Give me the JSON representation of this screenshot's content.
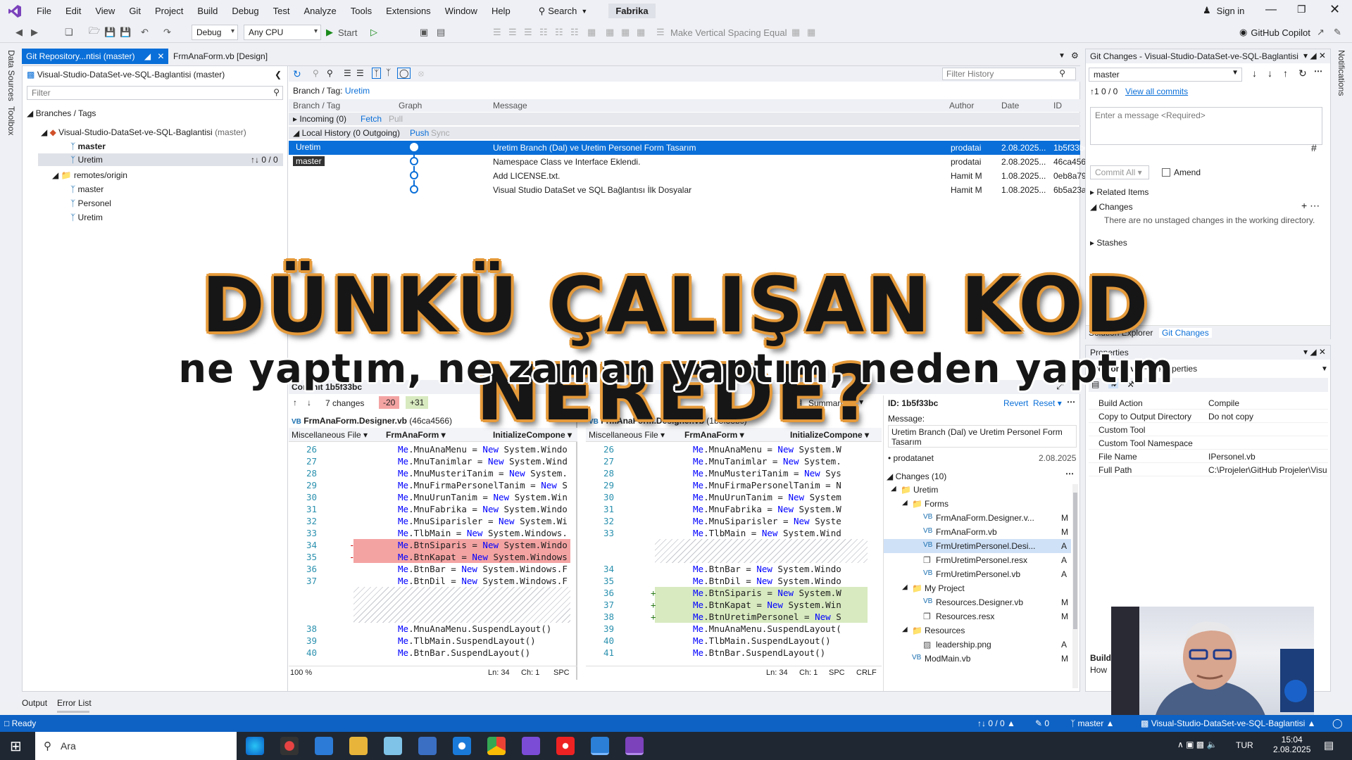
{
  "title_bar": {
    "menus": [
      "File",
      "Edit",
      "View",
      "Git",
      "Project",
      "Build",
      "Debug",
      "Test",
      "Analyze",
      "Tools",
      "Extensions",
      "Window",
      "Help"
    ],
    "search_label": "Search",
    "solution_name": "Fabrika",
    "sign_in": "Sign in"
  },
  "toolbar": {
    "config": "Debug",
    "platform": "Any CPU",
    "start_label": "Start",
    "vertical_spacing": "Make Vertical Spacing Equal",
    "copilot": "GitHub Copilot"
  },
  "left_strip": {
    "tab1": "Data Sources",
    "tab2": "Toolbox"
  },
  "doc_tabs": {
    "active": "Git Repository...ntisi (master)",
    "other": "FrmAnaForm.vb [Design]"
  },
  "repo": {
    "header": "Visual-Studio-DataSet-ve-SQL-Baglantisi (master)",
    "filter_placeholder": "Filter",
    "branches_title": "Branches / Tags",
    "repo_name": "Visual-Studio-DataSet-ve-SQL-Baglantisi",
    "repo_branch": "(master)",
    "local_master": "master",
    "local_uretim": "Uretim",
    "uretim_sync": "↑↓ 0 / 0",
    "remotes": "remotes/origin",
    "remote_branches": [
      "master",
      "Personel",
      "Uretim"
    ]
  },
  "history": {
    "filter_placeholder": "Filter History",
    "branch_label": "Branch / Tag:",
    "branch_value": "Uretim",
    "columns": {
      "branch": "Branch / Tag",
      "graph": "Graph",
      "message": "Message",
      "author": "Author",
      "date": "Date",
      "id": "ID"
    },
    "incoming": "Incoming (0)",
    "fetch": "Fetch",
    "pull": "Pull",
    "local": "Local History (0 Outgoing)",
    "push": "Push",
    "sync": "Sync",
    "commits": [
      {
        "tag": "Uretim",
        "message": "Uretim Branch (Dal) ve Uretim Personel Form Tasarım",
        "author": "prodatai",
        "date": "2.08.2025...",
        "id": "1b5f33bc"
      },
      {
        "tag": "master",
        "message": "Namespace Class ve Interface Eklendi.",
        "author": "prodatai",
        "date": "2.08.2025...",
        "id": "46ca4566"
      },
      {
        "tag": "",
        "message": "Add LICENSE.txt.",
        "author": "Hamit M",
        "date": "1.08.2025...",
        "id": "0eb8a79e"
      },
      {
        "tag": "",
        "message": "Visual Studio DataSet ve SQL Bağlantısı İlk Dosyalar",
        "author": "Hamit M",
        "date": "1.08.2025...",
        "id": "6b5a23ac"
      }
    ]
  },
  "commit_panel": {
    "title": "Commit 1b5f33bc",
    "changes_count": "7 changes",
    "removed": "-20",
    "added": "+31",
    "summary": "Summary",
    "left_file": "FrmAnaForm.Designer.vb",
    "left_rev": "(46ca4566)",
    "right_file": "FrmAnaForm.Designer.vb",
    "right_rev": "(1b5f33bc)",
    "combo_misc": "Miscellaneous File",
    "combo_class": "FrmAnaForm",
    "combo_method": "InitializeCompone",
    "zoom": "100 %",
    "status_ln": "Ln: 34",
    "status_ch": "Ch: 1",
    "status_spc": "SPC",
    "status_crlf": "CRLF",
    "left_lines": [
      {
        "n": "26",
        "code": "Me.MnuAnaMenu = New System.Windo"
      },
      {
        "n": "27",
        "code": "Me.MnuTanimlar = New System.Wind"
      },
      {
        "n": "28",
        "code": "Me.MnuMusteriTanim = New System."
      },
      {
        "n": "29",
        "code": "Me.MnuFirmaPersonelTanim = New S"
      },
      {
        "n": "30",
        "code": "Me.MnuUrunTanim = New System.Win"
      },
      {
        "n": "31",
        "code": "Me.MnuFabrika = New System.Windo"
      },
      {
        "n": "32",
        "code": "Me.MnuSiparisler = New System.Wi"
      },
      {
        "n": "33",
        "code": "Me.TlbMain = New System.Windows."
      },
      {
        "n": "34",
        "code": "Me.BtnSiparis = New System.Windo"
      },
      {
        "n": "35",
        "code": "Me.BtnKapat = New System.Windows"
      },
      {
        "n": "36",
        "code": "Me.BtnBar = New System.Windows.F"
      },
      {
        "n": "37",
        "code": "Me.BtnDil = New System.Windows.F"
      },
      {
        "n": "38",
        "code": "Me.MnuAnaMenu.SuspendLayout()"
      },
      {
        "n": "39",
        "code": "Me.TlbMain.SuspendLayout()"
      },
      {
        "n": "40",
        "code": "Me.BtnBar.SuspendLayout()"
      }
    ],
    "right_lines": [
      {
        "n": "26",
        "code": "Me.MnuAnaMenu = New System.W"
      },
      {
        "n": "27",
        "code": "Me.MnuTanimlar = New System."
      },
      {
        "n": "28",
        "code": "Me.MnuMusteriTanim = New Sys"
      },
      {
        "n": "29",
        "code": "Me.MnuFirmaPersonelTanim = N"
      },
      {
        "n": "30",
        "code": "Me.MnuUrunTanim = New System"
      },
      {
        "n": "31",
        "code": "Me.MnuFabrika = New System.W"
      },
      {
        "n": "32",
        "code": "Me.MnuSiparisler = New Syste"
      },
      {
        "n": "33",
        "code": "Me.TlbMain = New System.Wind"
      },
      {
        "n": "34",
        "code": "Me.BtnBar = New System.Windo"
      },
      {
        "n": "35",
        "code": "Me.BtnDil = New System.Windo"
      },
      {
        "n": "36",
        "code": "Me.BtnSiparis = New System.W"
      },
      {
        "n": "37",
        "code": "Me.BtnKapat = New System.Win"
      },
      {
        "n": "38",
        "code": "Me.BtnUretimPersonel = New S"
      },
      {
        "n": "39",
        "code": "Me.MnuAnaMenu.SuspendLayout("
      },
      {
        "n": "40",
        "code": "Me.TlbMain.SuspendLayout()"
      },
      {
        "n": "41",
        "code": "Me.BtnBar.SuspendLayout()"
      }
    ]
  },
  "commit_details": {
    "id": "ID: 1b5f33bc",
    "revert": "Revert",
    "reset": "Reset",
    "message_label": "Message:",
    "message": "Uretim Branch (Dal) ve Uretim Personel Form Tasarım",
    "author": "prodatanet",
    "date": "2.08.2025",
    "changes_title": "Changes (10)",
    "tree": [
      {
        "label": "Uretim",
        "status": "",
        "level": 1,
        "type": "folder"
      },
      {
        "label": "Forms",
        "status": "",
        "level": 2,
        "type": "folder"
      },
      {
        "label": "FrmAnaForm.Designer.v...",
        "status": "M",
        "level": 3,
        "type": "vb"
      },
      {
        "label": "FrmAnaForm.vb",
        "status": "M",
        "level": 3,
        "type": "vb"
      },
      {
        "label": "FrmUretimPersonel.Desi...",
        "status": "A",
        "level": 3,
        "type": "vb"
      },
      {
        "label": "FrmUretimPersonel.resx",
        "status": "A",
        "level": 3,
        "type": "resx"
      },
      {
        "label": "FrmUretimPersonel.vb",
        "status": "A",
        "level": 3,
        "type": "vb"
      },
      {
        "label": "My Project",
        "status": "",
        "level": 2,
        "type": "folder"
      },
      {
        "label": "Resources.Designer.vb",
        "status": "M",
        "level": 3,
        "type": "vb"
      },
      {
        "label": "Resources.resx",
        "status": "M",
        "level": 3,
        "type": "resx"
      },
      {
        "label": "Resources",
        "status": "",
        "level": 2,
        "type": "folder"
      },
      {
        "label": "leadership.png",
        "status": "A",
        "level": 3,
        "type": "png"
      },
      {
        "label": "ModMain.vb",
        "status": "M",
        "level": 2,
        "type": "vb"
      }
    ]
  },
  "git_changes": {
    "title": "Git Changes - Visual-Studio-DataSet-ve-SQL-Baglantisi",
    "branch": "master",
    "counts": "↑1 0 / 0",
    "view_all": "View all commits",
    "message_placeholder": "Enter a message <Required>",
    "commit_all": "Commit All",
    "amend": "Amend",
    "related": "Related Items",
    "changes": "Changes",
    "no_changes": "There are no unstaged changes in the working directory.",
    "stashes": "Stashes",
    "tab_solution": "Solution Explorer",
    "tab_git": "Git Changes"
  },
  "properties": {
    "title": "Properties",
    "file": "IPersonel.vb",
    "kind": "File Properties",
    "rows": [
      {
        "k": "Build Action",
        "v": "Compile"
      },
      {
        "k": "Copy to Output Directory",
        "v": "Do not copy"
      },
      {
        "k": "Custom Tool",
        "v": ""
      },
      {
        "k": "Custom Tool Namespace",
        "v": ""
      },
      {
        "k": "File Name",
        "v": "IPersonel.vb"
      },
      {
        "k": "Full Path",
        "v": "C:\\Projeler\\GitHub Projeler\\Visua"
      }
    ],
    "desc_title": "Build",
    "desc_text": "How"
  },
  "bottom_tabs": {
    "output": "Output",
    "errors": "Error List"
  },
  "right_strip": {
    "tab": "Notifications"
  },
  "status_bar": {
    "ready": "Ready",
    "sync": "↑↓ 0 / 0",
    "pencil": "0",
    "branch": "master",
    "repo": "Visual-Studio-DataSet-ve-SQL-Baglantisi"
  },
  "taskbar": {
    "search": "Ara",
    "lang": "TUR",
    "time": "15:04",
    "date": "2.08.2025"
  },
  "overlay": {
    "headline": "DÜNKÜ ÇALIŞAN KOD NEREDE?",
    "subline": "ne yaptım, ne zaman yaptım, neden yaptım"
  },
  "colors": {
    "accent": "#0a6fd8",
    "removed": "#f4a3a3",
    "added": "#d8eac0",
    "brand": "#7b42bc"
  }
}
